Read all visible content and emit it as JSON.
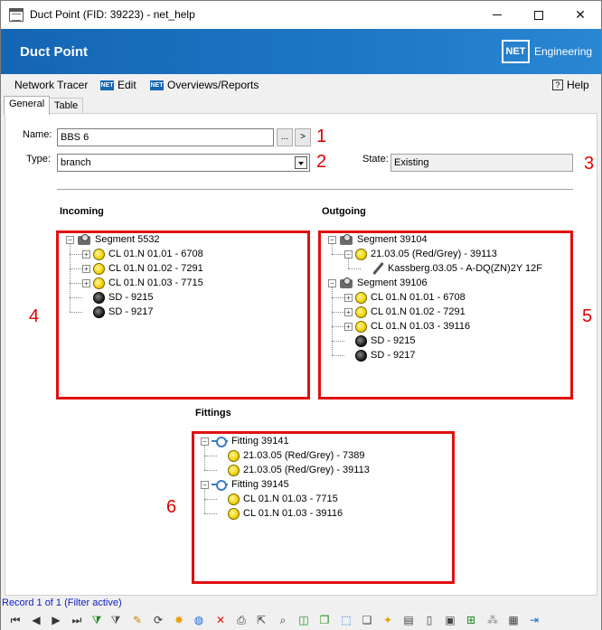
{
  "window": {
    "title": "Duct Point (FID: 39223) - net_help"
  },
  "banner": {
    "title": "Duct Point",
    "logo": "NET",
    "company": "Engineering"
  },
  "menu": {
    "network_tracer": "Network Tracer",
    "edit": "Edit",
    "overviews": "Overviews/Reports",
    "help": "Help",
    "net_badge": "NET"
  },
  "tabs": [
    "General",
    "Table"
  ],
  "form": {
    "name_label": "Name:",
    "name_value": "BBS 6",
    "browse_label": "...",
    "next_label": ">",
    "type_label": "Type:",
    "type_value": "branch",
    "state_label": "State:",
    "state_value": "Existing"
  },
  "annotations": [
    "1",
    "2",
    "3",
    "4",
    "5",
    "6"
  ],
  "sections": {
    "incoming": "Incoming",
    "outgoing": "Outgoing",
    "fittings": "Fittings"
  },
  "incoming_tree": [
    {
      "label": "Segment 5532",
      "icon": "segment-icon",
      "level": 0,
      "expander": "−"
    },
    {
      "label": "CL 01.N 01.01 - 6708",
      "icon": "yellow-cable-icon",
      "level": 1,
      "expander": "+"
    },
    {
      "label": "CL 01.N 01.02 - 7291",
      "icon": "yellow-cable-icon",
      "level": 1,
      "expander": "+"
    },
    {
      "label": "CL 01.N 01.03 - 7715",
      "icon": "yellow-cable-icon",
      "level": 1,
      "expander": "+"
    },
    {
      "label": "SD - 9215",
      "icon": "black-duct-icon",
      "level": 1,
      "expander": ""
    },
    {
      "label": "SD - 9217",
      "icon": "black-duct-icon",
      "level": 1,
      "expander": ""
    }
  ],
  "outgoing_tree": [
    {
      "label": "Segment 39104",
      "icon": "segment-icon",
      "level": 0,
      "expander": "−"
    },
    {
      "label": "21.03.05 (Red/Grey) - 39113",
      "icon": "yellow-cable-icon",
      "level": 1,
      "expander": "−"
    },
    {
      "label": "Kassberg.03.05 - A-DQ(ZN)2Y 12F",
      "icon": "cable-icon",
      "level": 2,
      "expander": ""
    },
    {
      "label": "Segment 39106",
      "icon": "segment-icon",
      "level": 0,
      "expander": "−"
    },
    {
      "label": "CL 01.N 01.01 - 6708",
      "icon": "yellow-cable-icon",
      "level": 1,
      "expander": "+"
    },
    {
      "label": "CL 01.N 01.02 - 7291",
      "icon": "yellow-cable-icon",
      "level": 1,
      "expander": "+"
    },
    {
      "label": "CL 01.N 01.03 - 39116",
      "icon": "yellow-cable-icon",
      "level": 1,
      "expander": "+"
    },
    {
      "label": "SD - 9215",
      "icon": "black-duct-icon",
      "level": 1,
      "expander": ""
    },
    {
      "label": "SD - 9217",
      "icon": "black-duct-icon",
      "level": 1,
      "expander": ""
    }
  ],
  "fittings_tree": [
    {
      "label": "Fitting 39141",
      "icon": "fitting-icon",
      "level": 0,
      "expander": "−"
    },
    {
      "label": "21.03.05 (Red/Grey) - 7389",
      "icon": "yellow-cable-icon",
      "level": 1,
      "expander": ""
    },
    {
      "label": "21.03.05 (Red/Grey) - 39113",
      "icon": "yellow-cable-icon",
      "level": 1,
      "expander": ""
    },
    {
      "label": "Fitting 39145",
      "icon": "fitting-icon",
      "level": 0,
      "expander": "−"
    },
    {
      "label": "CL 01.N 01.03 - 7715",
      "icon": "yellow-cable-icon",
      "level": 1,
      "expander": ""
    },
    {
      "label": "CL 01.N 01.03 - 39116",
      "icon": "yellow-cable-icon",
      "level": 1,
      "expander": ""
    }
  ],
  "status": {
    "record": "Record 1 of 1 (Filter active)"
  },
  "toolbar": {
    "buttons": [
      {
        "name": "first-record-icon",
        "glyph": "⏮",
        "color": "#333333"
      },
      {
        "name": "prev-record-icon",
        "glyph": "◀",
        "color": "#333333"
      },
      {
        "name": "next-record-icon",
        "glyph": "▶",
        "color": "#333333"
      },
      {
        "name": "last-record-icon",
        "glyph": "⏭",
        "color": "#333333"
      },
      {
        "name": "add-filter-icon",
        "glyph": "⧩",
        "color": "#1a8a1a"
      },
      {
        "name": "filter-icon",
        "glyph": "⧩",
        "color": "#555555"
      },
      {
        "name": "edit-pencil-icon",
        "glyph": "✎",
        "color": "#d08000"
      },
      {
        "name": "refresh-icon",
        "glyph": "⟳",
        "color": "#333333"
      },
      {
        "name": "new-icon",
        "glyph": "✸",
        "color": "#e8a000"
      },
      {
        "name": "globe-icon",
        "glyph": "◍",
        "color": "#1a6ad0"
      },
      {
        "name": "delete-icon",
        "glyph": "✕",
        "color": "#e01010"
      },
      {
        "name": "print-icon",
        "glyph": "⎙",
        "color": "#333333"
      },
      {
        "name": "select-icon",
        "glyph": "⇱",
        "color": "#333333"
      },
      {
        "name": "zoom-icon",
        "glyph": "⌕",
        "color": "#333333"
      },
      {
        "name": "highlight-icon",
        "glyph": "◫",
        "color": "#1a8a1a"
      },
      {
        "name": "copy-icon",
        "glyph": "❐",
        "color": "#1a8a1a"
      },
      {
        "name": "frame-icon",
        "glyph": "⬚",
        "color": "#1a6ad0"
      },
      {
        "name": "duplicate-icon",
        "glyph": "❏",
        "color": "#444444"
      },
      {
        "name": "document-new-icon",
        "glyph": "✦",
        "color": "#e8a000"
      },
      {
        "name": "report-icon",
        "glyph": "▤",
        "color": "#444444"
      },
      {
        "name": "document-icon",
        "glyph": "▯",
        "color": "#444444"
      },
      {
        "name": "image-icon",
        "glyph": "▣",
        "color": "#444444"
      },
      {
        "name": "add-document-icon",
        "glyph": "⊞",
        "color": "#1a8a1a"
      },
      {
        "name": "scatter-icon",
        "glyph": "⁂",
        "color": "#888888"
      },
      {
        "name": "table-icon",
        "glyph": "▦",
        "color": "#444444"
      },
      {
        "name": "exit-icon",
        "glyph": "⇥",
        "color": "#1a6ad0"
      }
    ]
  }
}
